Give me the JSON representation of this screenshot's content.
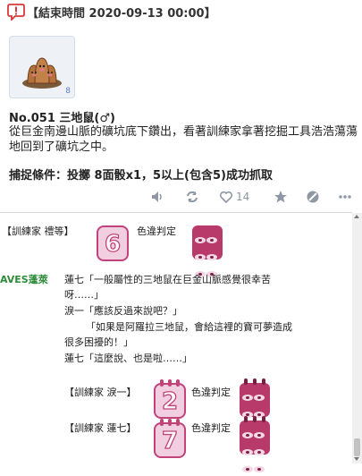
{
  "header": {
    "end_time_text": "【結束時間 2020-09-13 00:00】"
  },
  "pokemon": {
    "thumb_number": "8",
    "name_line": "No.051 三地鼠(♂)",
    "description": "從巨金南邊山脈的礦坑底下鑽出，看著訓練家拿著挖掘工具浩浩蕩蕩地回到了礦坑之中。",
    "capture_condition": "捕捉條件：投擲 8面骰x1，5以上(包含5)成功抓取"
  },
  "actions": {
    "like_count": "14"
  },
  "log": {
    "top_speaker": "【訓練家 禮等】",
    "top_die_value": "6",
    "top_judge_text": "色違判定",
    "author": "AVES蓬萊",
    "lines": [
      "蓮七「一般屬性的三地鼠在巨金山脈感覺很幸苦",
      "呀……」",
      "淚一「應該反過來說吧？」",
      "「如果是阿羅拉三地鼠，會給這裡的寶可夢造成",
      "很多困擾的！」",
      "蓮七「這麼說、也是啦……」"
    ],
    "roll1_speaker": "【訓練家 淚一】",
    "roll1_value": "2",
    "roll1_judge": "色違判定",
    "roll2_speaker": "【訓練家 蓮七】",
    "roll2_value": "7",
    "roll2_judge": "色違判定"
  },
  "colors": {
    "accent_red": "#d83a3a",
    "icon_gray": "#8e97a3",
    "die_pink": "#c1437a",
    "author_green": "#2e8b3a"
  },
  "icons": [
    "alert-speech-icon",
    "volume-icon",
    "repost-icon",
    "heart-icon",
    "star-icon",
    "block-icon",
    "more-icon"
  ]
}
